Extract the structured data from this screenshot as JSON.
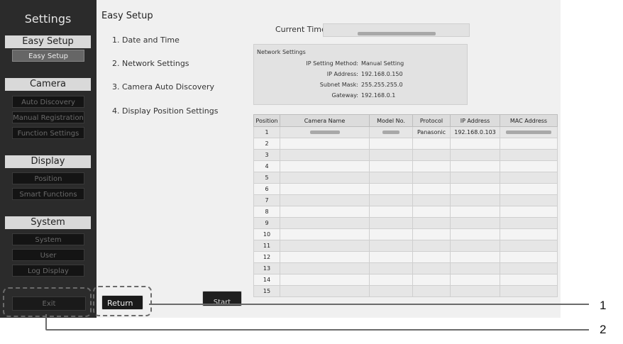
{
  "sidebar": {
    "title": "Settings",
    "sections": [
      {
        "header": "Easy Setup",
        "items": [
          {
            "label": "Easy Setup",
            "state": "selected"
          }
        ]
      },
      {
        "header": "Camera",
        "items": [
          {
            "label": "Auto Discovery",
            "state": "disabled"
          },
          {
            "label": "Manual Registration",
            "state": "disabled"
          },
          {
            "label": "Function Settings",
            "state": "disabled"
          }
        ]
      },
      {
        "header": "Display",
        "items": [
          {
            "label": "Position",
            "state": "disabled"
          },
          {
            "label": "Smart Functions",
            "state": "disabled"
          }
        ]
      },
      {
        "header": "System",
        "items": [
          {
            "label": "System",
            "state": "disabled"
          },
          {
            "label": "User",
            "state": "disabled"
          },
          {
            "label": "Log Display",
            "state": "disabled"
          }
        ]
      }
    ],
    "exit_label": "Exit"
  },
  "main": {
    "title": "Easy Setup",
    "steps": [
      "1. Date and Time",
      "2. Network Settings",
      "3. Camera Auto Discovery",
      "4. Display Position Settings"
    ],
    "current_time_label": "Current Time",
    "network": {
      "title": "Network Settings",
      "rows": [
        {
          "label": "IP Setting Method:",
          "value": "Manual Setting"
        },
        {
          "label": "IP Address:",
          "value": "192.168.0.150"
        },
        {
          "label": "Subnet Mask:",
          "value": "255.255.255.0"
        },
        {
          "label": "Gateway:",
          "value": "192.168.0.1"
        }
      ]
    },
    "table": {
      "headers": [
        "Position",
        "Camera Name",
        "Model No.",
        "Protocol",
        "IP Address",
        "MAC Address"
      ],
      "rows": [
        {
          "position": "1",
          "protocol": "Panasonic",
          "ip": "192.168.0.103"
        },
        {
          "position": "2"
        },
        {
          "position": "3"
        },
        {
          "position": "4"
        },
        {
          "position": "5"
        },
        {
          "position": "6"
        },
        {
          "position": "7"
        },
        {
          "position": "8"
        },
        {
          "position": "9"
        },
        {
          "position": "10"
        },
        {
          "position": "11"
        },
        {
          "position": "12"
        },
        {
          "position": "13"
        },
        {
          "position": "14"
        },
        {
          "position": "15"
        }
      ]
    },
    "return_label": "Return",
    "start_label": "Start"
  },
  "callouts": [
    "1",
    "2"
  ],
  "colors": {
    "screen_bg": "#2b2b2b",
    "panel_bg": "#f0f0f0",
    "callout_line": "#6b6b6b"
  }
}
